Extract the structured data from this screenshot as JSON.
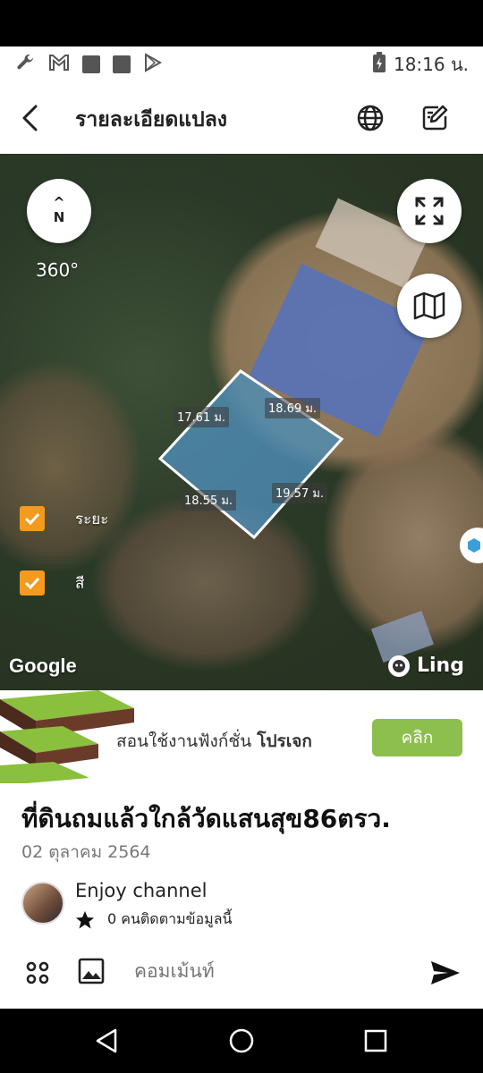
{
  "status_bar": {
    "time": "18:16 น.",
    "icons": [
      "wrench-icon",
      "gmail-icon",
      "app-icon",
      "app-icon",
      "play-store-icon",
      "battery-charging-icon"
    ]
  },
  "app_bar": {
    "title": "รายละเอียดแปลง",
    "icons": [
      "back-arrow-icon",
      "globe-icon",
      "edit-icon"
    ]
  },
  "map": {
    "compass_label": "N",
    "rotation": "360°",
    "dimensions": [
      "17.61 ม.",
      "18.69 ม.",
      "18.55 ม.",
      "19.57 ม."
    ],
    "toggles": [
      {
        "label": "ระยะ",
        "checked": true
      },
      {
        "label": "สี",
        "checked": true
      }
    ],
    "attribution_google": "Google",
    "attribution_ling": "Ling",
    "plot_fill_color": "#4f8fb8",
    "toggle_color": "#f39a1f"
  },
  "banner": {
    "text_prefix": "สอนใช้งานฟังก์ชั่น",
    "text_bold": "โปรเจก",
    "button_label": "คลิก",
    "button_color": "#8cbf4d"
  },
  "plot": {
    "title": "ที่ดินถมแล้วใกล้วัดแสนสุข86ตรว.",
    "date": "02 ตุลาคม 2564"
  },
  "owner": {
    "name": "Enjoy channel",
    "followers": "0 คนติดตามข้อมูลนี้"
  },
  "composer": {
    "placeholder": "คอมเม้นท์"
  }
}
